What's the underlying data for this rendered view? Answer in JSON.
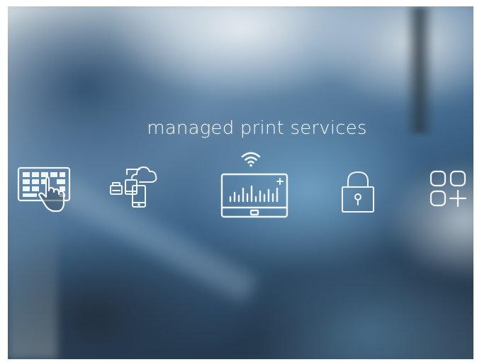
{
  "banner": {
    "headline": "managed print services"
  },
  "icons": [
    {
      "name": "keyboard-touch-icon"
    },
    {
      "name": "cloud-devices-icon"
    },
    {
      "name": "wifi-icon"
    },
    {
      "name": "analytics-monitor-icon"
    },
    {
      "name": "padlock-icon"
    },
    {
      "name": "add-apps-grid-icon"
    }
  ],
  "colors": {
    "text": "#f2f6f8",
    "icon_stroke": "#ffffff",
    "background_dark": "#24384d",
    "background_mid": "#3c6488",
    "background_light": "#d9dfe2"
  }
}
